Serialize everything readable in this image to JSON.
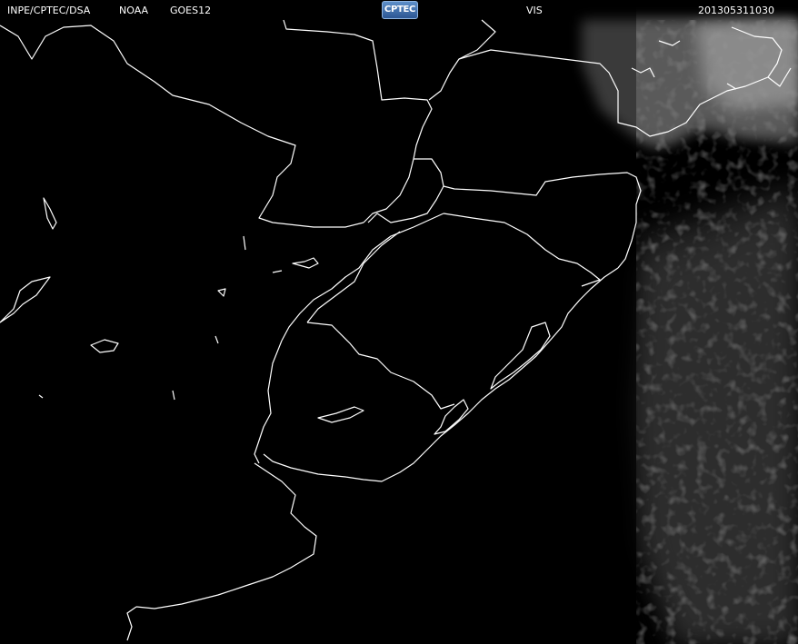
{
  "header": {
    "source": "INPE/CPTEC/DSA",
    "agency": "NOAA",
    "satellite": "GOES12",
    "logo_text": "CPTEC",
    "channel": "VIS",
    "timestamp": "201305311030"
  },
  "colors": {
    "background": "#000000",
    "coastline": "#ffffff",
    "header_text": "#ffffff",
    "cloud": "#7a7a7a"
  }
}
